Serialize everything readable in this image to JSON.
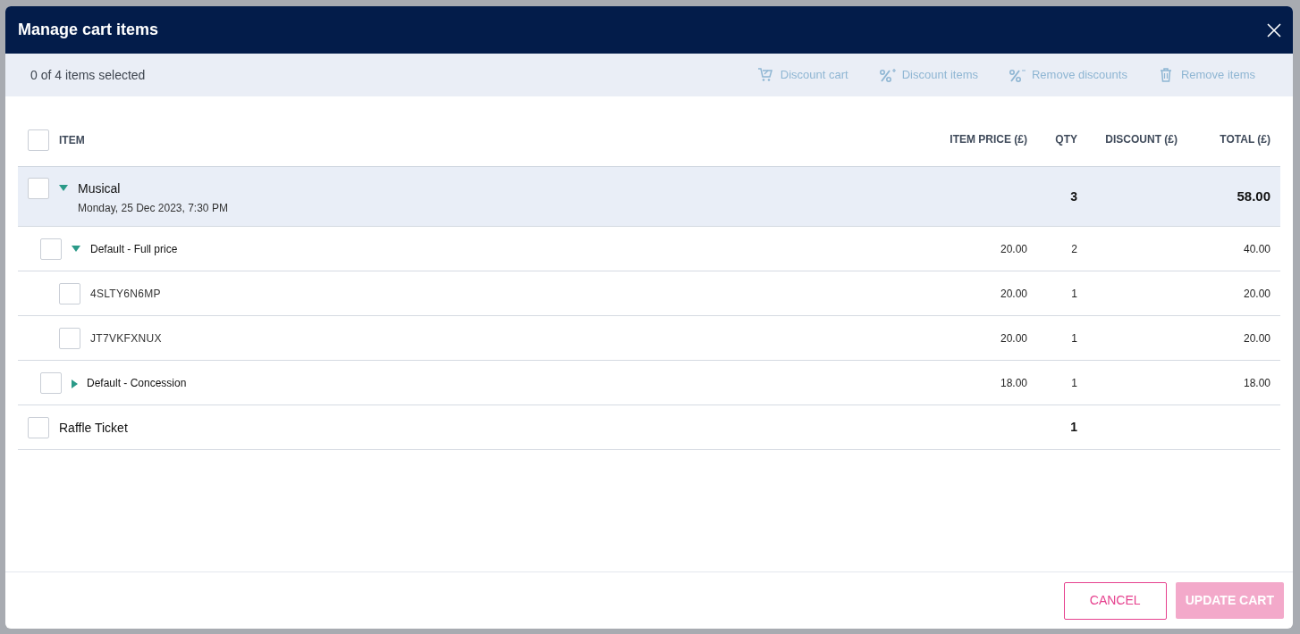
{
  "dialog": {
    "title": "Manage cart items"
  },
  "toolbar": {
    "selection_count": "0 of 4 items selected",
    "actions": [
      {
        "kind": "discount-cart",
        "label": "Discount cart",
        "disabled": true
      },
      {
        "kind": "discount-items",
        "label": "Discount items",
        "disabled": true
      },
      {
        "kind": "remove-discounts",
        "label": "Remove discounts",
        "disabled": true
      },
      {
        "kind": "remove-items",
        "label": "Remove items",
        "disabled": true
      }
    ]
  },
  "table": {
    "select_all_checked": false,
    "columns": [
      "ITEM",
      "ITEM PRICE (£)",
      "QTY",
      "DISCOUNT (£)",
      "TOTAL (£)"
    ],
    "rows": [
      {
        "kind": "event",
        "name": "Musical",
        "subtitle": "Monday, 25 Dec 2023, 7:30 PM",
        "qty": "3",
        "total": "58.00",
        "checked": false,
        "expanded": true,
        "children": [
          {
            "kind": "price-band",
            "name": "Default - Full price",
            "price": "20.00",
            "qty": "2",
            "total": "40.00",
            "checked": false,
            "expanded": true,
            "children": [
              {
                "kind": "ticket",
                "name": "4SLTY6N6MP",
                "price": "20.00",
                "qty": "1",
                "total": "20.00",
                "checked": false
              },
              {
                "kind": "ticket",
                "name": "JT7VKFXNUX",
                "price": "20.00",
                "qty": "1",
                "total": "20.00",
                "checked": false
              }
            ]
          },
          {
            "kind": "price-band",
            "name": "Default - Concession",
            "price": "18.00",
            "qty": "1",
            "total": "18.00",
            "checked": false,
            "expanded": false
          }
        ]
      },
      {
        "kind": "event",
        "name": "Raffle Ticket",
        "qty": "1",
        "checked": false
      }
    ]
  },
  "footer": {
    "buttons": [
      {
        "kind": "secondary",
        "label": "CANCEL",
        "disabled": false
      },
      {
        "kind": "primary",
        "label": "UPDATE CART",
        "disabled": true
      }
    ]
  }
}
